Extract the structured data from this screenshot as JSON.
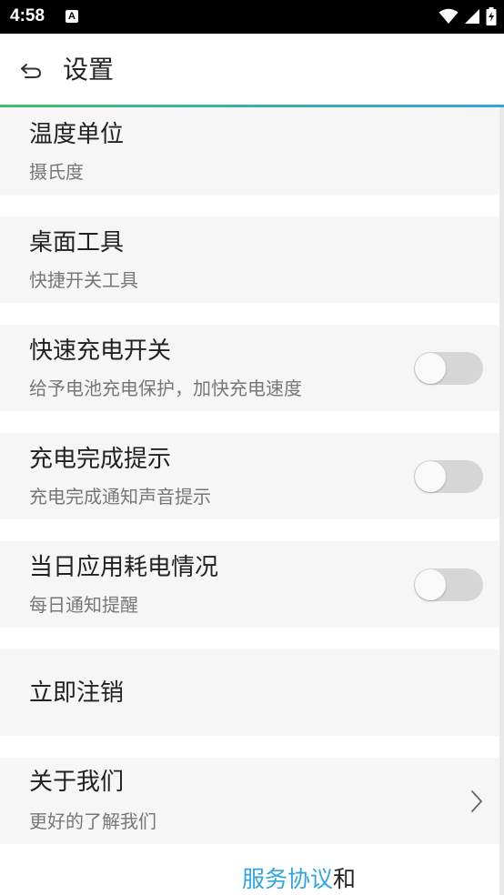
{
  "status_bar": {
    "time": "4:58",
    "notification_letter": "A"
  },
  "header": {
    "title": "设置"
  },
  "colors": {
    "accent_start": "#3ec06a",
    "accent_end": "#2ea7e0",
    "toggle_off": "#d6d6d6",
    "link": "#2ea7e0"
  },
  "settings": {
    "temperature_unit": {
      "title": "温度单位",
      "value": "摄氏度"
    },
    "desktop_tools": {
      "title": "桌面工具",
      "value": "快捷开关工具"
    },
    "fast_charge": {
      "title": "快速充电开关",
      "desc": "给予电池充电保护，加快充电速度",
      "enabled": false
    },
    "charge_complete": {
      "title": "充电完成提示",
      "desc": "充电完成通知声音提示",
      "enabled": false
    },
    "daily_usage": {
      "title": "当日应用耗电情况",
      "desc": "每日通知提醒",
      "enabled": false
    },
    "cancel_account": {
      "title": "立即注销"
    },
    "about": {
      "title": "关于我们",
      "desc": "更好的了解我们"
    }
  },
  "footer": {
    "service_agreement": "服务协议",
    "and": "和"
  }
}
